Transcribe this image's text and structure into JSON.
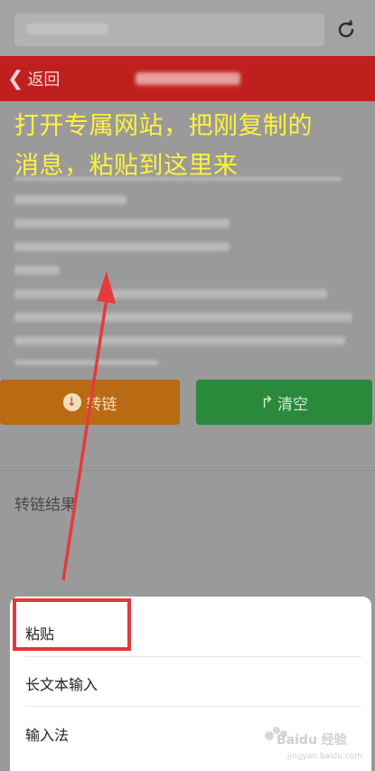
{
  "header": {
    "back_label": "返回"
  },
  "caption": {
    "line1": "打开专属网站，把刚复制的",
    "line2": "消息，粘贴到这里来"
  },
  "actions": {
    "convert_label": "转链",
    "clear_label": "清空"
  },
  "result": {
    "label": "转链结果"
  },
  "context_menu": {
    "items": [
      "粘贴",
      "长文本输入",
      "输入法"
    ]
  },
  "watermark": {
    "brand": "Baidu 经验",
    "url": "jingyan.baidu.com"
  },
  "colors": {
    "header_red": "#c0201d",
    "caption_yellow": "#fff23c",
    "highlight_red": "#e03a3a",
    "convert_orange": "#bb6a14",
    "clear_green": "#2a8a3c"
  },
  "icons": [
    "refresh-icon",
    "chevron-left-icon",
    "down-arrow-circle-icon",
    "redo-arrow-icon"
  ]
}
